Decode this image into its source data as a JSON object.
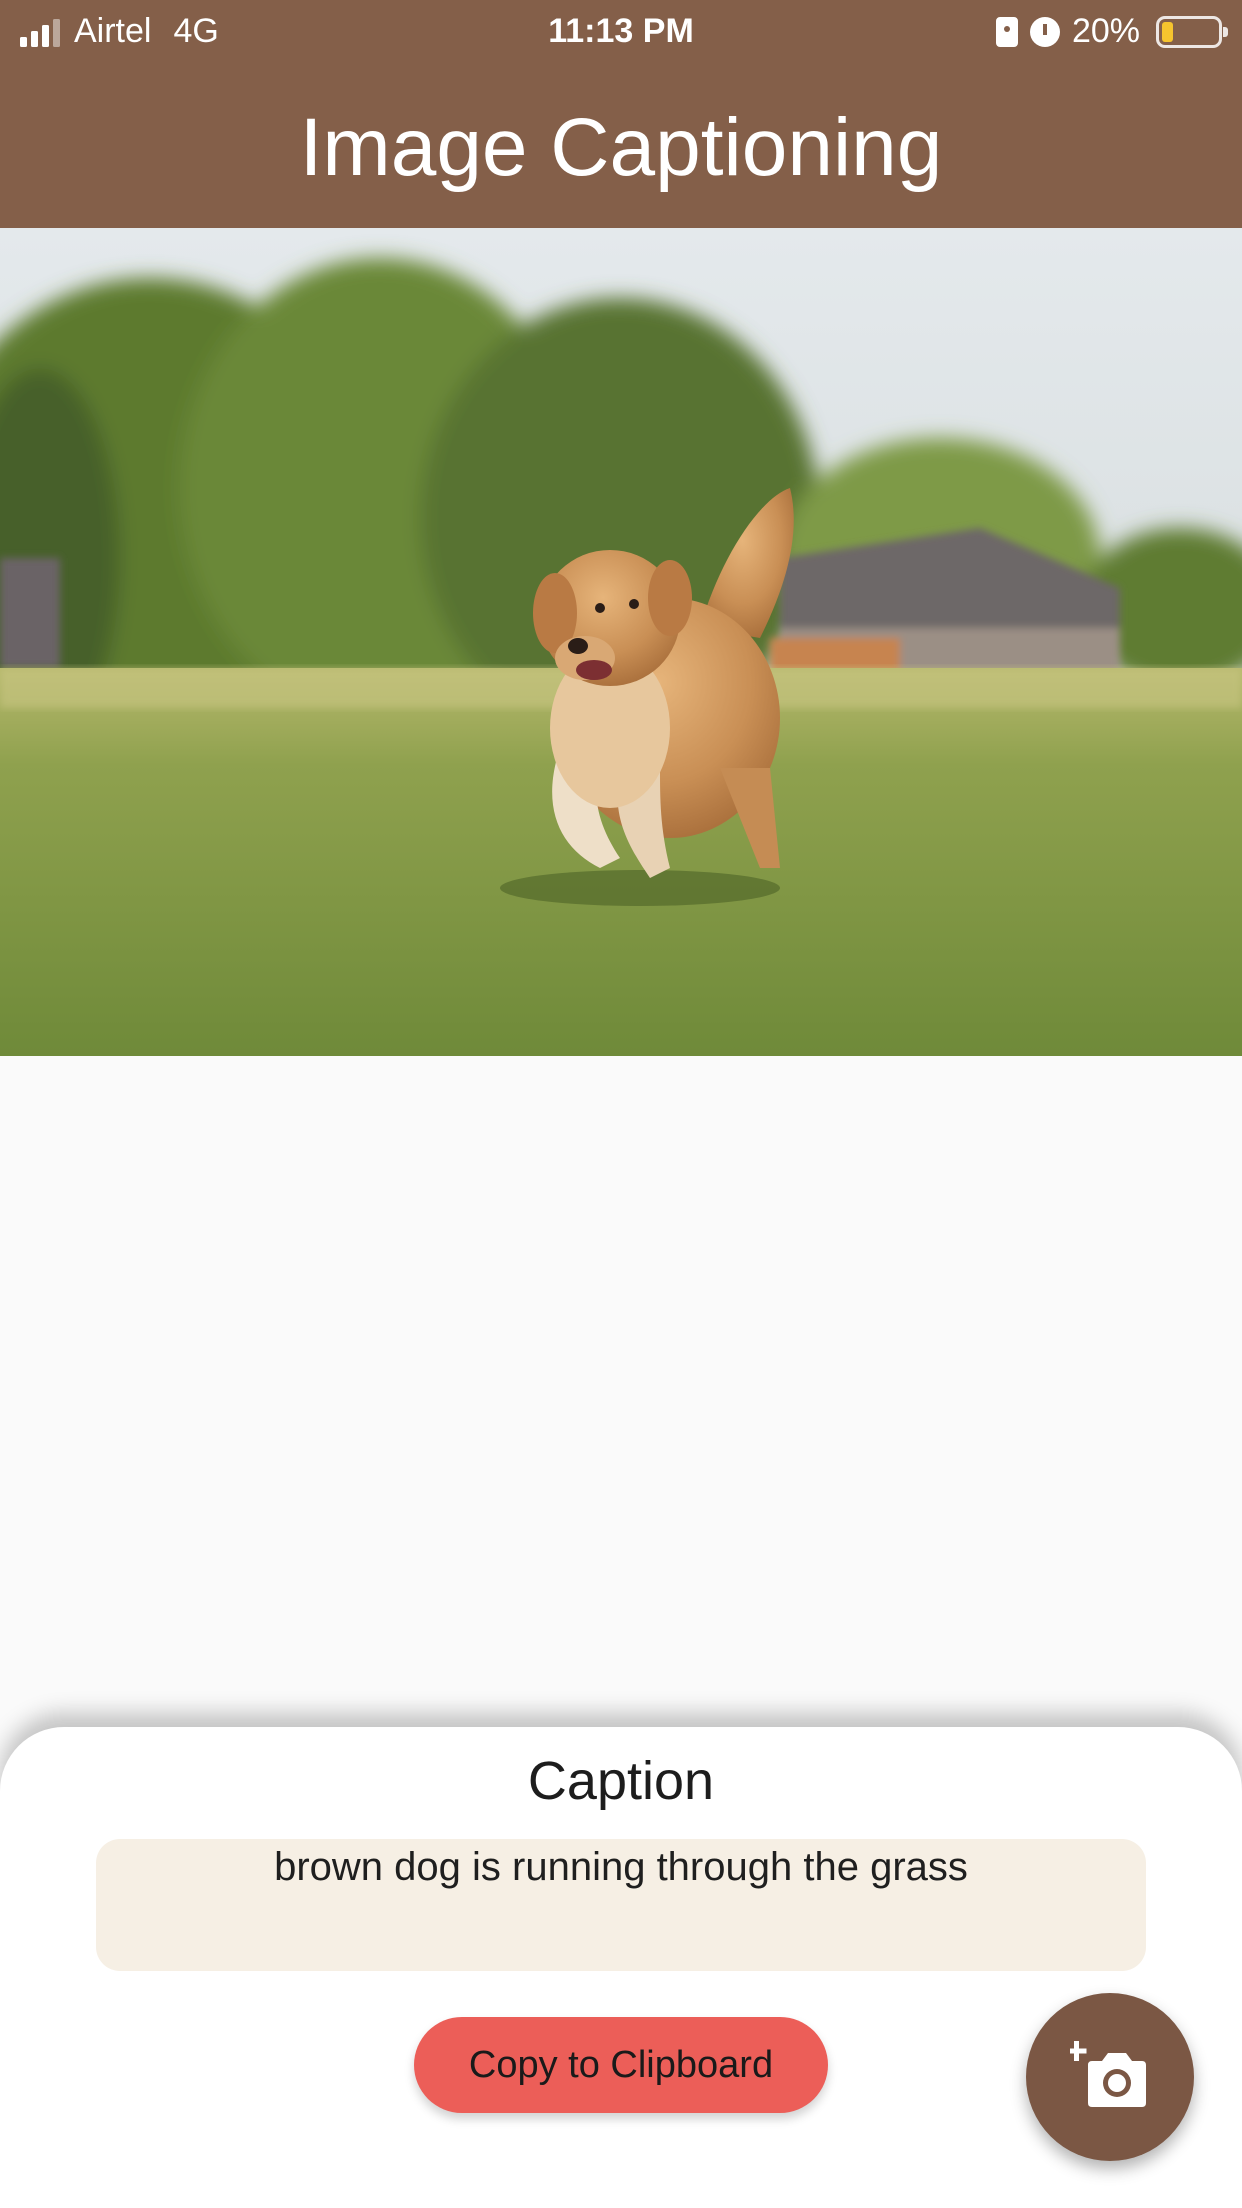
{
  "status_bar": {
    "carrier": "Airtel",
    "network": "4G",
    "time": "11:13 PM",
    "battery": "20%"
  },
  "app_bar": {
    "title": "Image Captioning"
  },
  "image": {
    "subject": "golden retriever running on grass"
  },
  "caption_sheet": {
    "title": "Caption",
    "caption_text": "brown dog is running through the grass",
    "copy_button_label": "Copy to Clipboard"
  },
  "fab": {
    "icon": "add-photo-camera-icon"
  },
  "colors": {
    "app_bar": "#845f49",
    "caption_box": "#f6efe4",
    "copy_button": "#ec5e58",
    "fab": "#7b5744",
    "battery_level": "#f6c42e"
  }
}
